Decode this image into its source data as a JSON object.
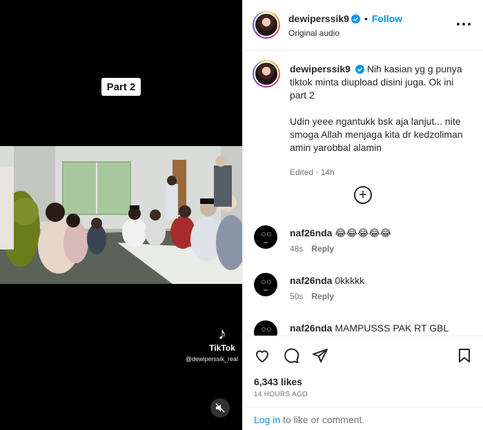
{
  "video": {
    "overlay_label": "Part 2",
    "tiktok_brand": "TikTok",
    "tiktok_user": "@dewiperssik_real",
    "mute_icon": "speaker-muted-icon"
  },
  "post": {
    "username": "dewiperssik9",
    "follow_label": "Follow",
    "audio_label": "Original audio",
    "caption": {
      "username": "dewiperssik9",
      "text_1": "Nih kasian yg g punya tiktok minta diupload disini juga. Ok ini part 2",
      "text_2": "Udin yeee ngantukk bsk aja lanjut... nite smoga Allah menjaga kita dr kedzoliman amin yarobbal alamin",
      "meta": "Edited · 14h"
    },
    "comments": [
      {
        "username": "naf26nda",
        "text": "😂😂😂😂😂",
        "time": "48s",
        "reply": "Reply"
      },
      {
        "username": "naf26nda",
        "text": "0kkkkk",
        "time": "50s",
        "reply": "Reply"
      },
      {
        "username": "naf26nda",
        "text": "MAMPUSSS PAK RT GBL",
        "time": "",
        "reply": ""
      }
    ],
    "likes": "6,343 likes",
    "time_ago": "14 HOURS AGO",
    "login_link": "Log in",
    "login_suffix": " to like or comment.",
    "accent_color": "#0095f6",
    "verified_color": "#0095f6"
  }
}
